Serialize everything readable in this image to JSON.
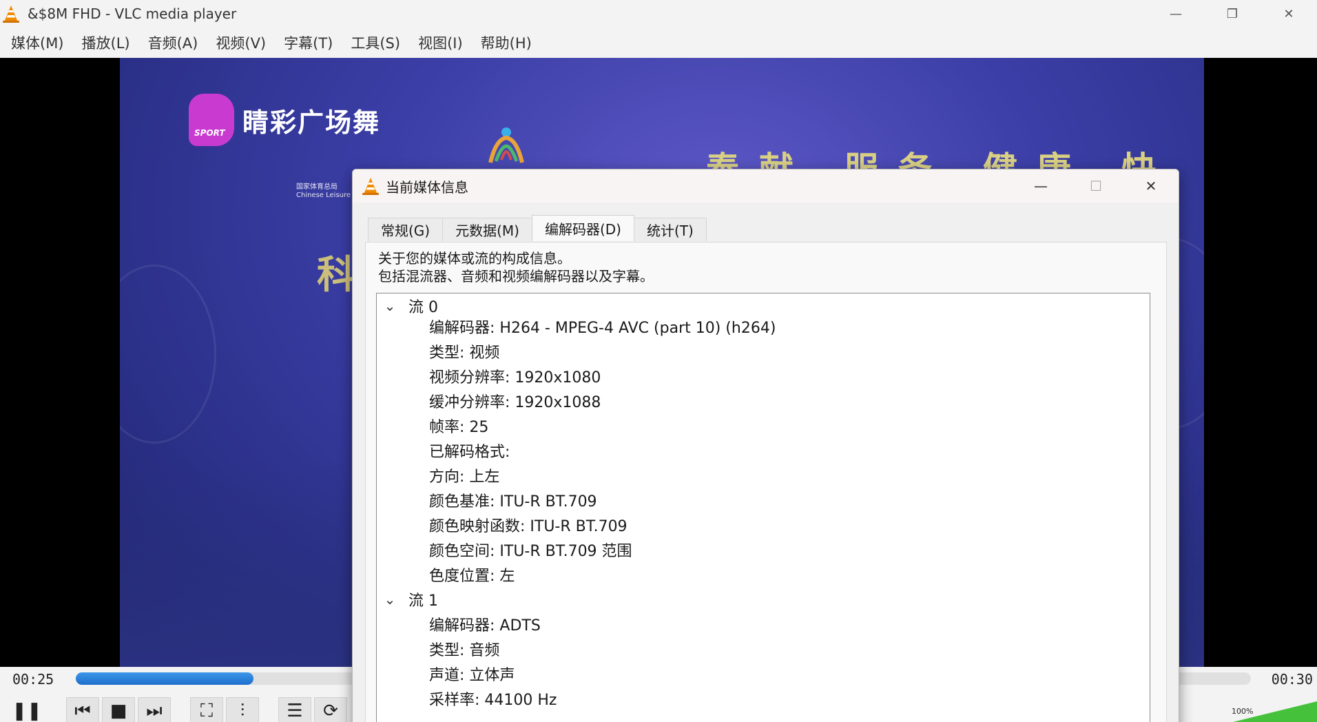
{
  "window": {
    "title": "&$8M FHD - VLC media player",
    "minimize_glyph": "—",
    "maximize_glyph": "❐",
    "close_glyph": "✕"
  },
  "menubar": {
    "items": [
      "媒体(M)",
      "播放(L)",
      "音频(A)",
      "视频(V)",
      "字幕(T)",
      "工具(S)",
      "视图(I)",
      "帮助(H)"
    ]
  },
  "video": {
    "channel_logo_badge": "SPORT",
    "channel_name": "睛彩广场舞",
    "org_line1": "国家体育总局",
    "org_line2": "Chinese Leisure Sp",
    "banner_text": "奉献 服务 健康 快乐",
    "side_glyph": "科"
  },
  "controls": {
    "elapsed": "00:25",
    "total": "00:30",
    "progress_fraction": 0.151,
    "volume_label": "100%",
    "buttons": {
      "play_pause": "❚❚",
      "previous": "⏮",
      "stop": "■",
      "next": "⏭",
      "fullscreen": "⛶",
      "extended": "⫶",
      "playlist": "☰",
      "loop": "⟳"
    }
  },
  "dialog": {
    "title": "当前媒体信息",
    "minimize_glyph": "—",
    "maximize_glyph": "☐",
    "close_glyph": "✕",
    "tabs": [
      "常规(G)",
      "元数据(M)",
      "编解码器(D)",
      "统计(T)"
    ],
    "active_tab": 2,
    "description_line1": "关于您的媒体或流的构成信息。",
    "description_line2": "包括混流器、音频和视频编解码器以及字幕。",
    "streams": [
      {
        "label": "流 0",
        "expanded_glyph": "⌄",
        "fields": [
          "编解码器: H264 - MPEG-4 AVC (part 10) (h264)",
          "类型: 视频",
          "视频分辨率: 1920x1080",
          "缓冲分辨率: 1920x1088",
          "帧率: 25",
          "已解码格式:",
          "方向: 上左",
          "颜色基准: ITU-R BT.709",
          "颜色映射函数: ITU-R BT.709",
          "颜色空间: ITU-R BT.709 范围",
          "色度位置: 左"
        ]
      },
      {
        "label": "流 1",
        "expanded_glyph": "⌄",
        "fields": [
          "编解码器: ADTS",
          "类型: 音频",
          "声道: 立体声",
          "采样率: 44100 Hz"
        ]
      }
    ]
  }
}
